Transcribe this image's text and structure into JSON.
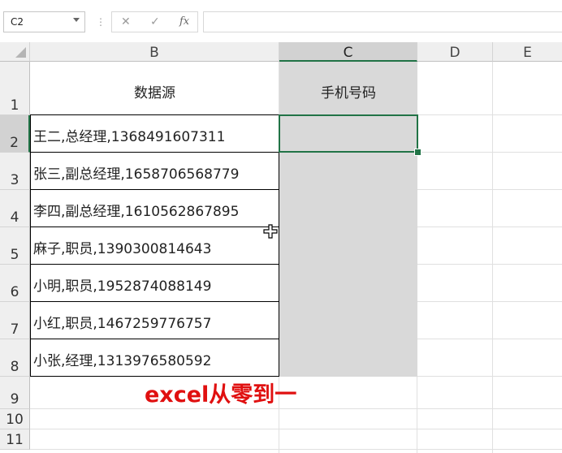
{
  "formula_bar": {
    "name_box": "C2",
    "separator": "⋮",
    "cancel_icon": "✕",
    "enter_icon": "✓",
    "fx_label": "fx",
    "formula_value": ""
  },
  "columns": [
    "B",
    "C",
    "D",
    "E"
  ],
  "selected_column": "C",
  "rows": [
    "1",
    "2",
    "3",
    "4",
    "5",
    "6",
    "7",
    "8",
    "9",
    "10",
    "11"
  ],
  "selected_row": "2",
  "headers": {
    "b1": "数据源",
    "c1": "手机号码"
  },
  "data_rows": [
    "王二,总经理,1368491607311",
    "张三,副总经理,1658706568779",
    "李四,副总经理,1610562867895",
    "麻子,职员,1390300814643",
    "小明,职员,1952874088149",
    "小红,职员,1467259776757",
    "小张,经理,1313976580592"
  ],
  "caption": "excel从零到一",
  "colors": {
    "accent_green": "#217346",
    "caption_red": "#e01010",
    "shaded_column": "#d9d9d9"
  },
  "icons": {
    "cursor": "cell-select-cursor-icon",
    "name_box_dropdown": "chevron-down-icon"
  }
}
